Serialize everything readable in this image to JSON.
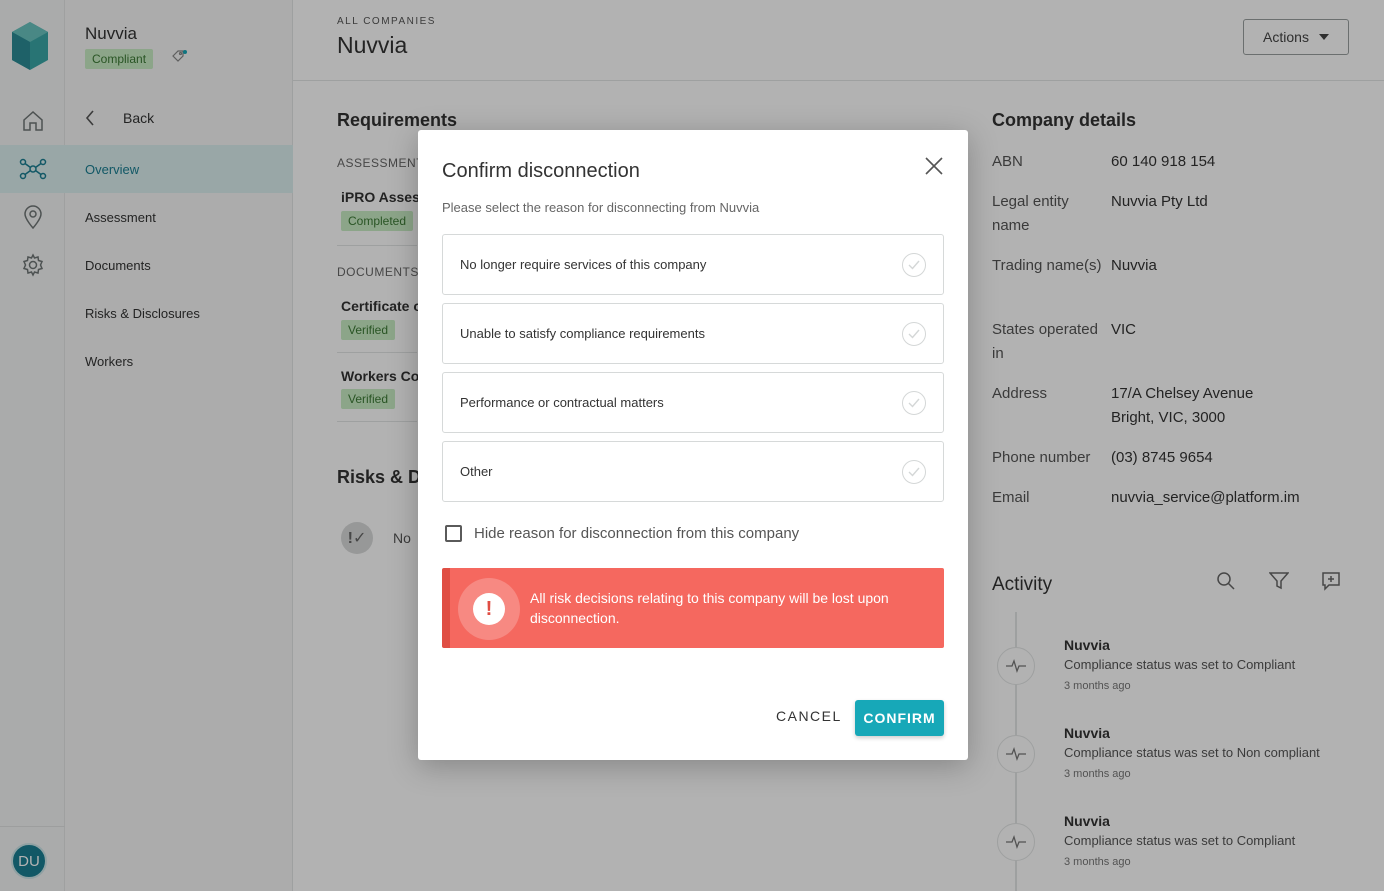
{
  "sidebar": {
    "company_name": "Nuvvia",
    "status_badge": "Compliant",
    "back_label": "Back",
    "nav": [
      "Overview",
      "Assessment",
      "Documents",
      "Risks & Disclosures",
      "Workers"
    ],
    "avatar_initials": "DU"
  },
  "header": {
    "breadcrumb": "ALL COMPANIES",
    "title": "Nuvvia",
    "actions_label": "Actions"
  },
  "requirements": {
    "heading": "Requirements",
    "assessment_label": "ASSESSMENT",
    "assessment_item": "iPRO Assess",
    "assessment_badge": "Completed",
    "documents_label": "DOCUMENTS",
    "doc1": "Certificate o",
    "doc1_badge": "Verified",
    "doc2": "Workers Co",
    "doc2_badge": "Verified"
  },
  "risks": {
    "heading": "Risks & D",
    "empty_text": "No"
  },
  "company_details": {
    "heading": "Company details",
    "rows": [
      {
        "key": "ABN",
        "value": "60 140 918 154"
      },
      {
        "key": "Legal entity name",
        "value": "Nuvvia Pty Ltd"
      },
      {
        "key": "Trading name(s)",
        "value": "Nuvvia"
      },
      {
        "key": "States operated in",
        "value": "VIC"
      },
      {
        "key": "Address",
        "value": "17/A Chelsey Avenue Bright, VIC, 3000"
      },
      {
        "key": "Phone number",
        "value": "(03) 8745 9654"
      },
      {
        "key": "Email",
        "value": "nuvvia_service@platform.im"
      }
    ]
  },
  "activity": {
    "heading": "Activity",
    "entries": [
      {
        "who": "Nuvvia",
        "what": "Compliance status was set to Compliant",
        "when": "3 months ago"
      },
      {
        "who": "Nuvvia",
        "what": "Compliance status was set to Non compliant",
        "when": "3 months ago"
      },
      {
        "who": "Nuvvia",
        "what": "Compliance status was set to Compliant",
        "when": "3 months ago"
      }
    ]
  },
  "modal": {
    "title": "Confirm disconnection",
    "subtitle": "Please select the reason for disconnecting from Nuvvia",
    "options": [
      "No longer require services of this company",
      "Unable to satisfy compliance requirements",
      "Performance or contractual matters",
      "Other"
    ],
    "hide_label": "Hide reason for disconnection from this company",
    "warning": "All risk decisions relating to this company will be lost upon disconnection.",
    "cancel_label": "CANCEL",
    "confirm_label": "CONFIRM"
  },
  "colors": {
    "accent": "#17a8b8",
    "danger": "#f5685f",
    "success_bg": "#c9ecc4"
  }
}
